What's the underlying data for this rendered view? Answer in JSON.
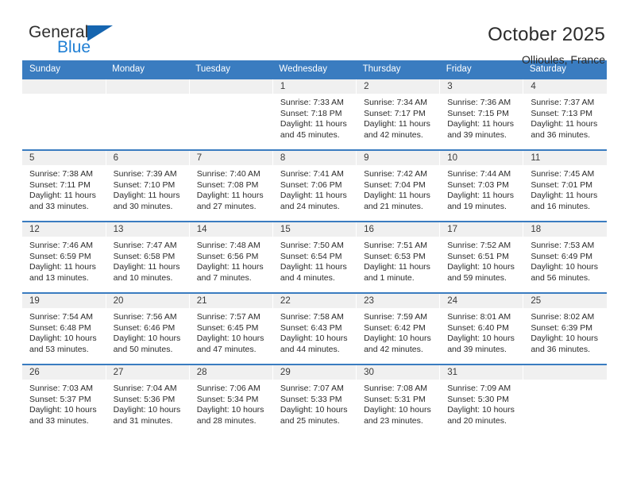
{
  "brand": {
    "name_top": "General",
    "name_bottom": "Blue",
    "triangle_color": "#1565b0",
    "blue_text_color": "#1f7fd4"
  },
  "header": {
    "title": "October 2025",
    "subtitle": "Ollioules, France"
  },
  "theme": {
    "header_blue": "#3a7cc0",
    "daynum_band": "#f0f0f0",
    "text": "#2b2b2b"
  },
  "labels": {
    "sunrise_prefix": "Sunrise:",
    "sunset_prefix": "Sunset:",
    "daylight_prefix": "Daylight:"
  },
  "weekdays": [
    "Sunday",
    "Monday",
    "Tuesday",
    "Wednesday",
    "Thursday",
    "Friday",
    "Saturday"
  ],
  "weeks": [
    [
      {
        "day": "",
        "empty": true,
        "sunrise": "",
        "sunset": "",
        "daylight_line1": "",
        "daylight_line2": ""
      },
      {
        "day": "",
        "empty": true,
        "sunrise": "",
        "sunset": "",
        "daylight_line1": "",
        "daylight_line2": ""
      },
      {
        "day": "",
        "empty": true,
        "sunrise": "",
        "sunset": "",
        "daylight_line1": "",
        "daylight_line2": ""
      },
      {
        "day": "1",
        "empty": false,
        "sunrise": "Sunrise: 7:33 AM",
        "sunset": "Sunset: 7:18 PM",
        "daylight_line1": "Daylight: 11 hours",
        "daylight_line2": "and 45 minutes."
      },
      {
        "day": "2",
        "empty": false,
        "sunrise": "Sunrise: 7:34 AM",
        "sunset": "Sunset: 7:17 PM",
        "daylight_line1": "Daylight: 11 hours",
        "daylight_line2": "and 42 minutes."
      },
      {
        "day": "3",
        "empty": false,
        "sunrise": "Sunrise: 7:36 AM",
        "sunset": "Sunset: 7:15 PM",
        "daylight_line1": "Daylight: 11 hours",
        "daylight_line2": "and 39 minutes."
      },
      {
        "day": "4",
        "empty": false,
        "sunrise": "Sunrise: 7:37 AM",
        "sunset": "Sunset: 7:13 PM",
        "daylight_line1": "Daylight: 11 hours",
        "daylight_line2": "and 36 minutes."
      }
    ],
    [
      {
        "day": "5",
        "empty": false,
        "sunrise": "Sunrise: 7:38 AM",
        "sunset": "Sunset: 7:11 PM",
        "daylight_line1": "Daylight: 11 hours",
        "daylight_line2": "and 33 minutes."
      },
      {
        "day": "6",
        "empty": false,
        "sunrise": "Sunrise: 7:39 AM",
        "sunset": "Sunset: 7:10 PM",
        "daylight_line1": "Daylight: 11 hours",
        "daylight_line2": "and 30 minutes."
      },
      {
        "day": "7",
        "empty": false,
        "sunrise": "Sunrise: 7:40 AM",
        "sunset": "Sunset: 7:08 PM",
        "daylight_line1": "Daylight: 11 hours",
        "daylight_line2": "and 27 minutes."
      },
      {
        "day": "8",
        "empty": false,
        "sunrise": "Sunrise: 7:41 AM",
        "sunset": "Sunset: 7:06 PM",
        "daylight_line1": "Daylight: 11 hours",
        "daylight_line2": "and 24 minutes."
      },
      {
        "day": "9",
        "empty": false,
        "sunrise": "Sunrise: 7:42 AM",
        "sunset": "Sunset: 7:04 PM",
        "daylight_line1": "Daylight: 11 hours",
        "daylight_line2": "and 21 minutes."
      },
      {
        "day": "10",
        "empty": false,
        "sunrise": "Sunrise: 7:44 AM",
        "sunset": "Sunset: 7:03 PM",
        "daylight_line1": "Daylight: 11 hours",
        "daylight_line2": "and 19 minutes."
      },
      {
        "day": "11",
        "empty": false,
        "sunrise": "Sunrise: 7:45 AM",
        "sunset": "Sunset: 7:01 PM",
        "daylight_line1": "Daylight: 11 hours",
        "daylight_line2": "and 16 minutes."
      }
    ],
    [
      {
        "day": "12",
        "empty": false,
        "sunrise": "Sunrise: 7:46 AM",
        "sunset": "Sunset: 6:59 PM",
        "daylight_line1": "Daylight: 11 hours",
        "daylight_line2": "and 13 minutes."
      },
      {
        "day": "13",
        "empty": false,
        "sunrise": "Sunrise: 7:47 AM",
        "sunset": "Sunset: 6:58 PM",
        "daylight_line1": "Daylight: 11 hours",
        "daylight_line2": "and 10 minutes."
      },
      {
        "day": "14",
        "empty": false,
        "sunrise": "Sunrise: 7:48 AM",
        "sunset": "Sunset: 6:56 PM",
        "daylight_line1": "Daylight: 11 hours",
        "daylight_line2": "and 7 minutes."
      },
      {
        "day": "15",
        "empty": false,
        "sunrise": "Sunrise: 7:50 AM",
        "sunset": "Sunset: 6:54 PM",
        "daylight_line1": "Daylight: 11 hours",
        "daylight_line2": "and 4 minutes."
      },
      {
        "day": "16",
        "empty": false,
        "sunrise": "Sunrise: 7:51 AM",
        "sunset": "Sunset: 6:53 PM",
        "daylight_line1": "Daylight: 11 hours",
        "daylight_line2": "and 1 minute."
      },
      {
        "day": "17",
        "empty": false,
        "sunrise": "Sunrise: 7:52 AM",
        "sunset": "Sunset: 6:51 PM",
        "daylight_line1": "Daylight: 10 hours",
        "daylight_line2": "and 59 minutes."
      },
      {
        "day": "18",
        "empty": false,
        "sunrise": "Sunrise: 7:53 AM",
        "sunset": "Sunset: 6:49 PM",
        "daylight_line1": "Daylight: 10 hours",
        "daylight_line2": "and 56 minutes."
      }
    ],
    [
      {
        "day": "19",
        "empty": false,
        "sunrise": "Sunrise: 7:54 AM",
        "sunset": "Sunset: 6:48 PM",
        "daylight_line1": "Daylight: 10 hours",
        "daylight_line2": "and 53 minutes."
      },
      {
        "day": "20",
        "empty": false,
        "sunrise": "Sunrise: 7:56 AM",
        "sunset": "Sunset: 6:46 PM",
        "daylight_line1": "Daylight: 10 hours",
        "daylight_line2": "and 50 minutes."
      },
      {
        "day": "21",
        "empty": false,
        "sunrise": "Sunrise: 7:57 AM",
        "sunset": "Sunset: 6:45 PM",
        "daylight_line1": "Daylight: 10 hours",
        "daylight_line2": "and 47 minutes."
      },
      {
        "day": "22",
        "empty": false,
        "sunrise": "Sunrise: 7:58 AM",
        "sunset": "Sunset: 6:43 PM",
        "daylight_line1": "Daylight: 10 hours",
        "daylight_line2": "and 44 minutes."
      },
      {
        "day": "23",
        "empty": false,
        "sunrise": "Sunrise: 7:59 AM",
        "sunset": "Sunset: 6:42 PM",
        "daylight_line1": "Daylight: 10 hours",
        "daylight_line2": "and 42 minutes."
      },
      {
        "day": "24",
        "empty": false,
        "sunrise": "Sunrise: 8:01 AM",
        "sunset": "Sunset: 6:40 PM",
        "daylight_line1": "Daylight: 10 hours",
        "daylight_line2": "and 39 minutes."
      },
      {
        "day": "25",
        "empty": false,
        "sunrise": "Sunrise: 8:02 AM",
        "sunset": "Sunset: 6:39 PM",
        "daylight_line1": "Daylight: 10 hours",
        "daylight_line2": "and 36 minutes."
      }
    ],
    [
      {
        "day": "26",
        "empty": false,
        "sunrise": "Sunrise: 7:03 AM",
        "sunset": "Sunset: 5:37 PM",
        "daylight_line1": "Daylight: 10 hours",
        "daylight_line2": "and 33 minutes."
      },
      {
        "day": "27",
        "empty": false,
        "sunrise": "Sunrise: 7:04 AM",
        "sunset": "Sunset: 5:36 PM",
        "daylight_line1": "Daylight: 10 hours",
        "daylight_line2": "and 31 minutes."
      },
      {
        "day": "28",
        "empty": false,
        "sunrise": "Sunrise: 7:06 AM",
        "sunset": "Sunset: 5:34 PM",
        "daylight_line1": "Daylight: 10 hours",
        "daylight_line2": "and 28 minutes."
      },
      {
        "day": "29",
        "empty": false,
        "sunrise": "Sunrise: 7:07 AM",
        "sunset": "Sunset: 5:33 PM",
        "daylight_line1": "Daylight: 10 hours",
        "daylight_line2": "and 25 minutes."
      },
      {
        "day": "30",
        "empty": false,
        "sunrise": "Sunrise: 7:08 AM",
        "sunset": "Sunset: 5:31 PM",
        "daylight_line1": "Daylight: 10 hours",
        "daylight_line2": "and 23 minutes."
      },
      {
        "day": "31",
        "empty": false,
        "sunrise": "Sunrise: 7:09 AM",
        "sunset": "Sunset: 5:30 PM",
        "daylight_line1": "Daylight: 10 hours",
        "daylight_line2": "and 20 minutes."
      },
      {
        "day": "",
        "empty": true,
        "sunrise": "",
        "sunset": "",
        "daylight_line1": "",
        "daylight_line2": ""
      }
    ]
  ]
}
